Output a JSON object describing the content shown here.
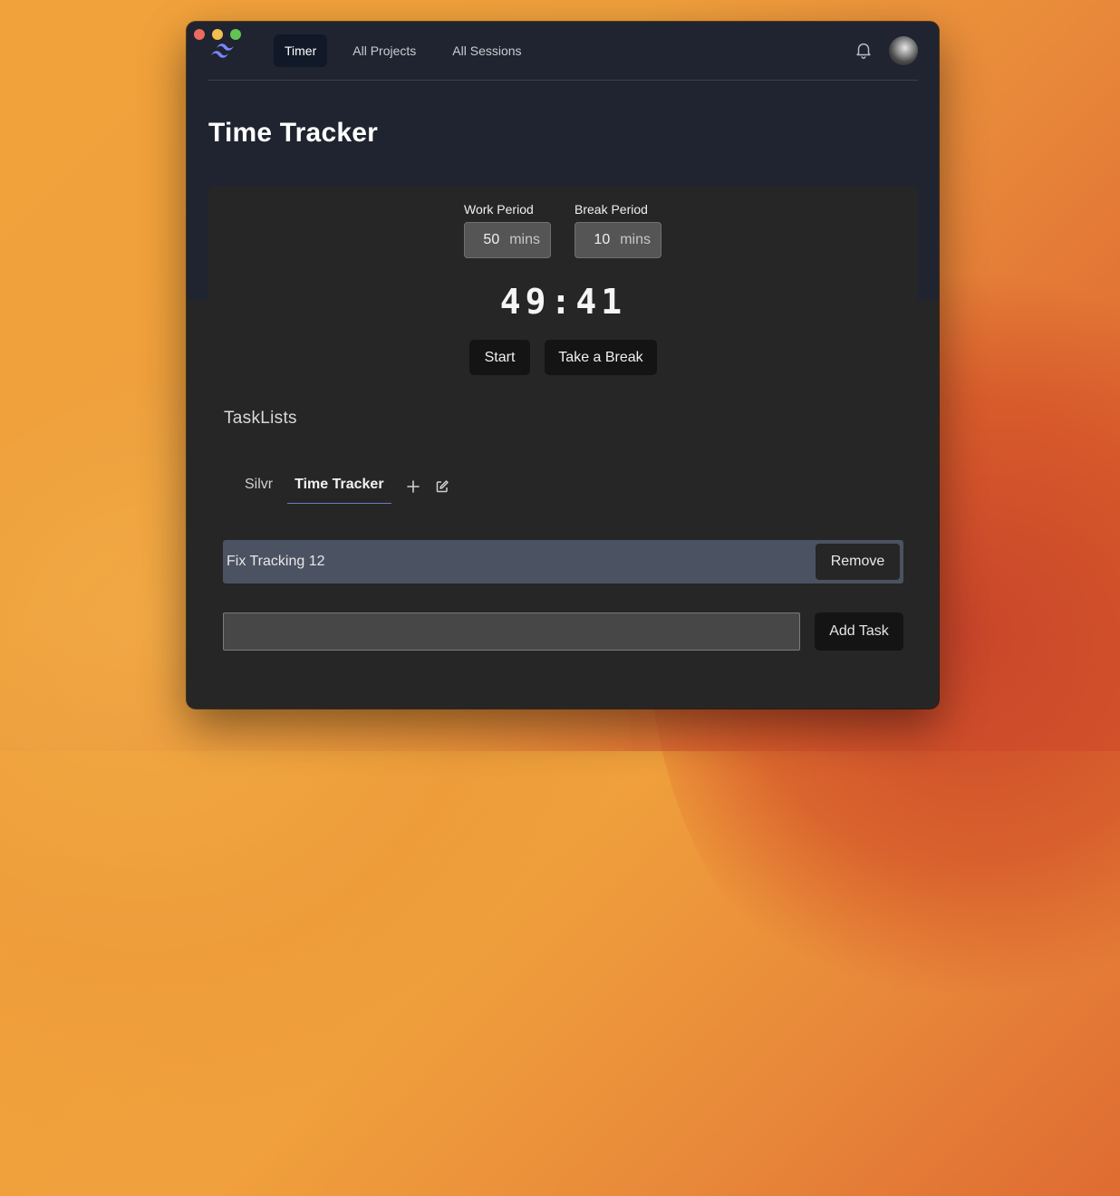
{
  "nav": {
    "items": [
      {
        "label": "Timer",
        "active": true
      },
      {
        "label": "All Projects",
        "active": false
      },
      {
        "label": "All Sessions",
        "active": false
      }
    ],
    "icons": {
      "logo": "tailwind-logo-icon",
      "notifications": "bell-icon"
    }
  },
  "page": {
    "title": "Time Tracker"
  },
  "timer": {
    "work_period": {
      "label": "Work Period",
      "value": "50",
      "unit": "mins"
    },
    "break_period": {
      "label": "Break Period",
      "value": "10",
      "unit": "mins"
    },
    "display": "49:41",
    "start_label": "Start",
    "break_label": "Take a Break"
  },
  "tasklists": {
    "title": "TaskLists",
    "tabs": [
      {
        "label": "Silvr",
        "active": false
      },
      {
        "label": "Time Tracker",
        "active": true
      }
    ],
    "tasks": [
      {
        "text": "Fix Tracking 12",
        "remove_label": "Remove"
      }
    ],
    "new_task_value": "",
    "add_task_label": "Add Task"
  },
  "colors": {
    "accent": "#6b7cc4",
    "window_top": "#1f2430",
    "window_body": "#262626"
  }
}
